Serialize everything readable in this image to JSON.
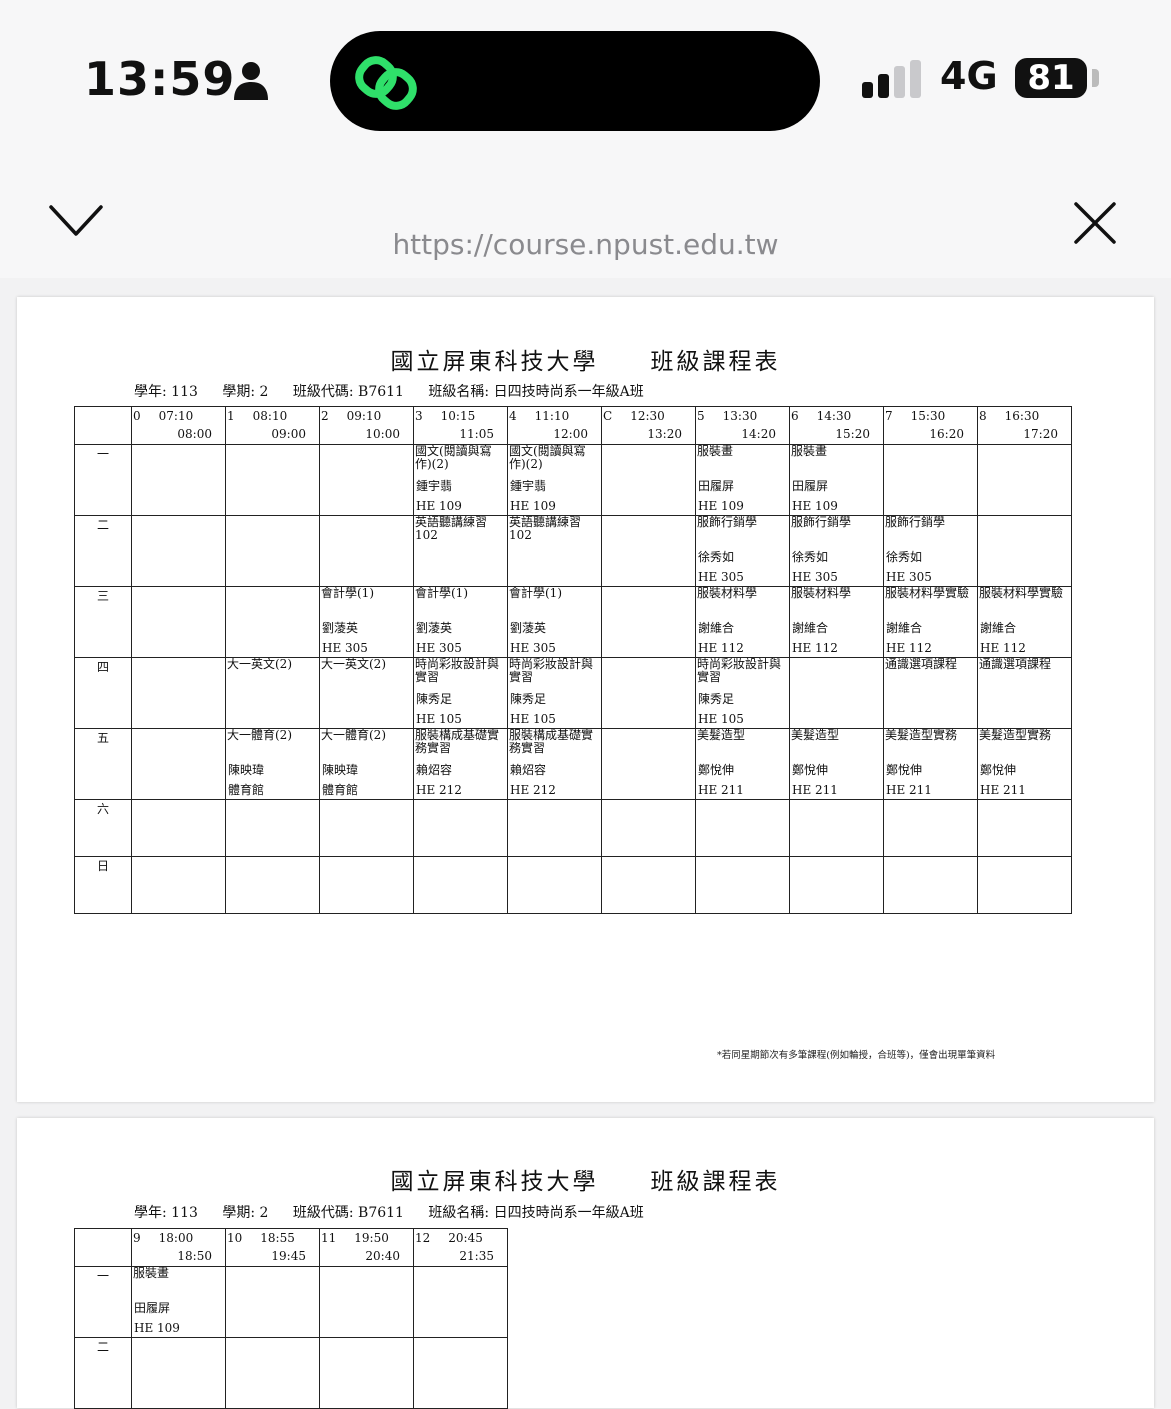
{
  "status": {
    "time": "13:59",
    "network": "4G",
    "battery": "81"
  },
  "browser": {
    "url": "https://course.npust.edu.tw"
  },
  "doc": {
    "title": "國立屏東科技大學　　班級課程表",
    "meta": {
      "year": "學年: 113",
      "term": "學期: 2",
      "class_code": "班級代碼: B7611",
      "class_name": "班級名稱: 日四技時尚系一年級A班"
    },
    "footnote": "*若同星期節次有多筆課程(例如輪授，合班等)，僅會出現單筆資料"
  },
  "periods": [
    {
      "no": "0",
      "start": "07:10",
      "end": "08:00"
    },
    {
      "no": "1",
      "start": "08:10",
      "end": "09:00"
    },
    {
      "no": "2",
      "start": "09:10",
      "end": "10:00"
    },
    {
      "no": "3",
      "start": "10:15",
      "end": "11:05"
    },
    {
      "no": "4",
      "start": "11:10",
      "end": "12:00"
    },
    {
      "no": "C",
      "start": "12:30",
      "end": "13:20"
    },
    {
      "no": "5",
      "start": "13:30",
      "end": "14:20"
    },
    {
      "no": "6",
      "start": "14:30",
      "end": "15:20"
    },
    {
      "no": "7",
      "start": "15:30",
      "end": "16:20"
    },
    {
      "no": "8",
      "start": "16:30",
      "end": "17:20"
    }
  ],
  "days": [
    {
      "label": "一",
      "cells": [
        {},
        {},
        {},
        {
          "course": "國文(閱讀與寫作)(2)",
          "teacher": "鍾宇翡",
          "room": "HE 109"
        },
        {
          "course": "國文(閱讀與寫作)(2)",
          "teacher": "鍾宇翡",
          "room": "HE 109"
        },
        {},
        {
          "course": "服裝畫",
          "teacher": "田履屏",
          "room": "HE 109"
        },
        {
          "course": "服裝畫",
          "teacher": "田履屏",
          "room": "HE 109"
        },
        {},
        {}
      ]
    },
    {
      "label": "二",
      "cells": [
        {},
        {},
        {},
        {
          "course": "英語聽講練習 102"
        },
        {
          "course": "英語聽講練習 102"
        },
        {},
        {
          "course": "服飾行銷學",
          "teacher": "徐秀如",
          "room": "HE 305"
        },
        {
          "course": "服飾行銷學",
          "teacher": "徐秀如",
          "room": "HE 305"
        },
        {
          "course": "服飾行銷學",
          "teacher": "徐秀如",
          "room": "HE 305"
        },
        {}
      ]
    },
    {
      "label": "三",
      "cells": [
        {},
        {},
        {
          "course": "會計學(1)",
          "teacher": "劉蓤英",
          "room": "HE 305"
        },
        {
          "course": "會計學(1)",
          "teacher": "劉蓤英",
          "room": "HE 305"
        },
        {
          "course": "會計學(1)",
          "teacher": "劉蓤英",
          "room": "HE 305"
        },
        {},
        {
          "course": "服裝材料學",
          "teacher": "謝維合",
          "room": "HE 112"
        },
        {
          "course": "服裝材料學",
          "teacher": "謝維合",
          "room": "HE 112"
        },
        {
          "course": "服裝材料學實驗",
          "teacher": "謝維合",
          "room": "HE 112"
        },
        {
          "course": "服裝材料學實驗",
          "teacher": "謝維合",
          "room": "HE 112"
        }
      ]
    },
    {
      "label": "四",
      "cells": [
        {},
        {
          "course": "大一英文(2)"
        },
        {
          "course": "大一英文(2)"
        },
        {
          "course": "時尚彩妝設計與實習",
          "teacher": "陳秀足",
          "room": "HE 105"
        },
        {
          "course": "時尚彩妝設計與實習",
          "teacher": "陳秀足",
          "room": "HE 105"
        },
        {},
        {
          "course": "時尚彩妝設計與實習",
          "teacher": "陳秀足",
          "room": "HE 105"
        },
        {},
        {
          "course": "通識選項課程"
        },
        {
          "course": "通識選項課程"
        }
      ]
    },
    {
      "label": "五",
      "cells": [
        {},
        {
          "course": "大一體育(2)",
          "teacher": "陳映瑋",
          "room": "體育館"
        },
        {
          "course": "大一體育(2)",
          "teacher": "陳映瑋",
          "room": "體育館"
        },
        {
          "course": "服裝構成基礎實務實習",
          "teacher": "賴炤容",
          "room": "HE 212"
        },
        {
          "course": "服裝構成基礎實務實習",
          "teacher": "賴炤容",
          "room": "HE 212"
        },
        {},
        {
          "course": "美髮造型",
          "teacher": "鄭悅伸",
          "room": "HE 211"
        },
        {
          "course": "美髮造型",
          "teacher": "鄭悅伸",
          "room": "HE 211"
        },
        {
          "course": "美髮造型實務",
          "teacher": "鄭悅伸",
          "room": "HE 211"
        },
        {
          "course": "美髮造型實務",
          "teacher": "鄭悅伸",
          "room": "HE 211"
        }
      ]
    },
    {
      "label": "六",
      "cells": [
        {},
        {},
        {},
        {},
        {},
        {},
        {},
        {},
        {},
        {}
      ]
    },
    {
      "label": "日",
      "cells": [
        {},
        {},
        {},
        {},
        {},
        {},
        {},
        {},
        {},
        {}
      ]
    }
  ],
  "periods2": [
    {
      "no": "9",
      "start": "18:00",
      "end": "18:50"
    },
    {
      "no": "10",
      "start": "18:55",
      "end": "19:45"
    },
    {
      "no": "11",
      "start": "19:50",
      "end": "20:40"
    },
    {
      "no": "12",
      "start": "20:45",
      "end": "21:35"
    }
  ],
  "days2": [
    {
      "label": "一",
      "cells": [
        {
          "course": "服裝畫",
          "teacher": "田履屏",
          "room": "HE 109"
        },
        {},
        {},
        {}
      ]
    },
    {
      "label": "二",
      "cells": [
        {},
        {},
        {},
        {}
      ]
    }
  ]
}
